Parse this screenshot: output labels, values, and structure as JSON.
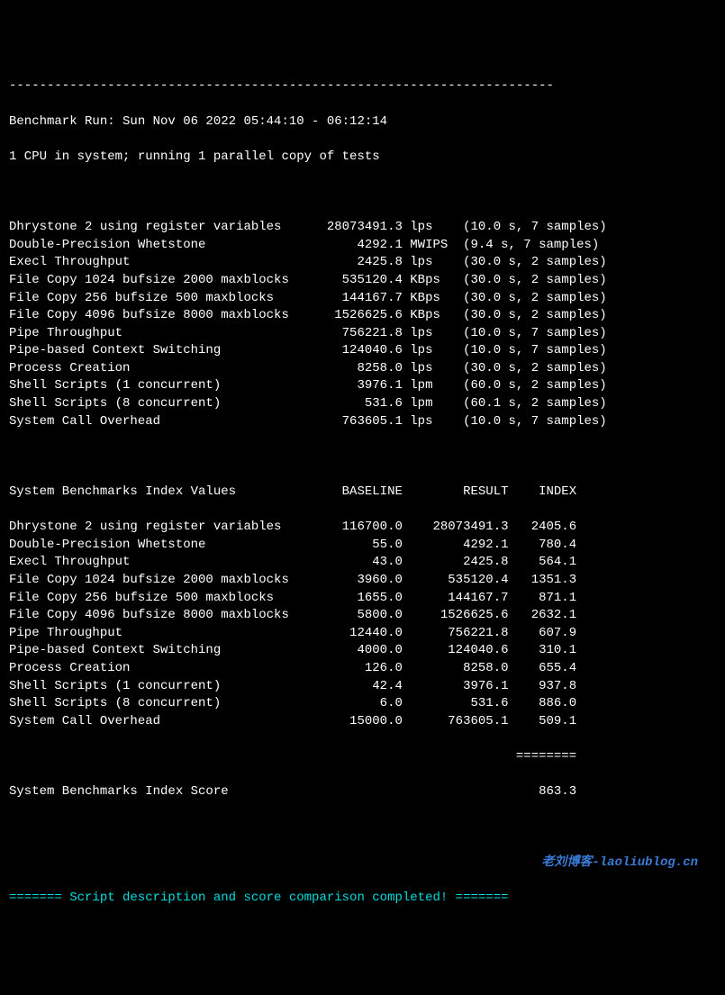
{
  "divider_top": "------------------------------------------------------------------------",
  "header": {
    "run_line": "Benchmark Run: Sun Nov 06 2022 05:44:10 - 06:12:14",
    "cpu_line": "1 CPU in system; running 1 parallel copy of tests"
  },
  "results": [
    {
      "name": "Dhrystone 2 using register variables",
      "value": "28073491.3",
      "unit": "lps",
      "timing": "(10.0 s, 7 samples)"
    },
    {
      "name": "Double-Precision Whetstone",
      "value": "4292.1",
      "unit": "MWIPS",
      "timing": "(9.4 s, 7 samples)"
    },
    {
      "name": "Execl Throughput",
      "value": "2425.8",
      "unit": "lps",
      "timing": "(30.0 s, 2 samples)"
    },
    {
      "name": "File Copy 1024 bufsize 2000 maxblocks",
      "value": "535120.4",
      "unit": "KBps",
      "timing": "(30.0 s, 2 samples)"
    },
    {
      "name": "File Copy 256 bufsize 500 maxblocks",
      "value": "144167.7",
      "unit": "KBps",
      "timing": "(30.0 s, 2 samples)"
    },
    {
      "name": "File Copy 4096 bufsize 8000 maxblocks",
      "value": "1526625.6",
      "unit": "KBps",
      "timing": "(30.0 s, 2 samples)"
    },
    {
      "name": "Pipe Throughput",
      "value": "756221.8",
      "unit": "lps",
      "timing": "(10.0 s, 7 samples)"
    },
    {
      "name": "Pipe-based Context Switching",
      "value": "124040.6",
      "unit": "lps",
      "timing": "(10.0 s, 7 samples)"
    },
    {
      "name": "Process Creation",
      "value": "8258.0",
      "unit": "lps",
      "timing": "(30.0 s, 2 samples)"
    },
    {
      "name": "Shell Scripts (1 concurrent)",
      "value": "3976.1",
      "unit": "lpm",
      "timing": "(60.0 s, 2 samples)"
    },
    {
      "name": "Shell Scripts (8 concurrent)",
      "value": "531.6",
      "unit": "lpm",
      "timing": "(60.1 s, 2 samples)"
    },
    {
      "name": "System Call Overhead",
      "value": "763605.1",
      "unit": "lps",
      "timing": "(10.0 s, 7 samples)"
    }
  ],
  "index_header": {
    "title": "System Benchmarks Index Values",
    "col_baseline": "BASELINE",
    "col_result": "RESULT",
    "col_index": "INDEX"
  },
  "index_rows": [
    {
      "name": "Dhrystone 2 using register variables",
      "baseline": "116700.0",
      "result": "28073491.3",
      "index": "2405.6"
    },
    {
      "name": "Double-Precision Whetstone",
      "baseline": "55.0",
      "result": "4292.1",
      "index": "780.4"
    },
    {
      "name": "Execl Throughput",
      "baseline": "43.0",
      "result": "2425.8",
      "index": "564.1"
    },
    {
      "name": "File Copy 1024 bufsize 2000 maxblocks",
      "baseline": "3960.0",
      "result": "535120.4",
      "index": "1351.3"
    },
    {
      "name": "File Copy 256 bufsize 500 maxblocks",
      "baseline": "1655.0",
      "result": "144167.7",
      "index": "871.1"
    },
    {
      "name": "File Copy 4096 bufsize 8000 maxblocks",
      "baseline": "5800.0",
      "result": "1526625.6",
      "index": "2632.1"
    },
    {
      "name": "Pipe Throughput",
      "baseline": "12440.0",
      "result": "756221.8",
      "index": "607.9"
    },
    {
      "name": "Pipe-based Context Switching",
      "baseline": "4000.0",
      "result": "124040.6",
      "index": "310.1"
    },
    {
      "name": "Process Creation",
      "baseline": "126.0",
      "result": "8258.0",
      "index": "655.4"
    },
    {
      "name": "Shell Scripts (1 concurrent)",
      "baseline": "42.4",
      "result": "3976.1",
      "index": "937.8"
    },
    {
      "name": "Shell Scripts (8 concurrent)",
      "baseline": "6.0",
      "result": "531.6",
      "index": "886.0"
    },
    {
      "name": "System Call Overhead",
      "baseline": "15000.0",
      "result": "763605.1",
      "index": "509.1"
    }
  ],
  "score_divider": "                                                                   ========",
  "score_line": {
    "label": "System Benchmarks Index Score",
    "value": "863.3"
  },
  "watermark": "老刘博客-laoliublog.cn",
  "footer": "======= Script description and score comparison completed! ======="
}
